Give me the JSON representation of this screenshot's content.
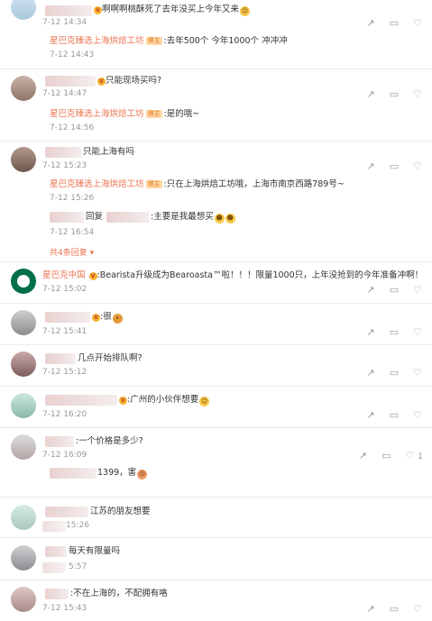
{
  "brand_account": "星巴克臻选上海烘焙工坊",
  "official_account": "星巴克中国",
  "author_badge": "博主",
  "comments": [
    {
      "prefix": "",
      "text": "啊啊啊桃酥死了去年没买上今年又来",
      "time": "7-12 14:34"
    },
    {
      "reply": {
        "text": ":去年500个 今年1000个 冲冲冲",
        "time": "7-12 14:43"
      }
    },
    {
      "text": "只能现场买吗?",
      "time": "7-12 14:47"
    },
    {
      "reply": {
        "text": ":是的哦~",
        "time": "7-12 14:56"
      }
    },
    {
      "text": "只能上海有吗",
      "time": "7-12 15:23"
    },
    {
      "reply": {
        "text": ":只在上海烘焙工坊哦，上海市南京西路789号~",
        "time": "7-12 15:26"
      }
    },
    {
      "reply2": {
        "prefix": "回复",
        "text": ":主要是我最想买",
        "time": "7-12 16:54"
      }
    },
    {
      "more": "共4条回复"
    },
    {
      "text": ":Bearista升级成为Bearoasta™啦！！！限量1000只，上年没抢到的今年准备冲啊！",
      "time": "7-12 15:02"
    },
    {
      "text": ":很",
      "time": "7-12 15:41"
    },
    {
      "text": "几点开始排队啊?",
      "time": "7-12 15:12"
    },
    {
      "text": ":广州的小伙伴想要",
      "time": "7-12 16:20"
    },
    {
      "text": ":一个价格是多少?",
      "time": "7-12 16:09",
      "likes": "1"
    },
    {
      "reply": {
        "text": "1399，害",
        "time": ""
      }
    },
    {
      "text": "江苏的朋友想要",
      "time": "15:26"
    },
    {
      "text": "每天有限量吗",
      "time": "5:57"
    },
    {
      "text": ":不在上海的，不配拥有咯",
      "time": "7-12 15:43"
    }
  ],
  "icons": {
    "share": "share-icon",
    "comment": "comment-icon",
    "like": "thumbs-up-icon"
  }
}
